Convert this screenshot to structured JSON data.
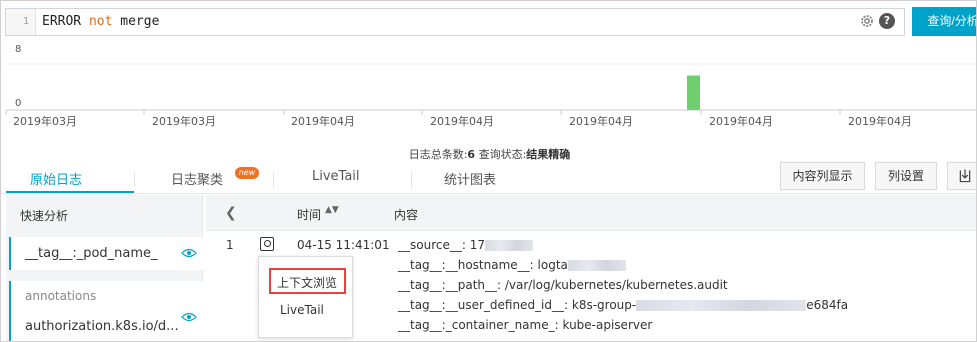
{
  "query": {
    "line_number": "1",
    "term1": "ERROR",
    "term2": "not",
    "term3": "merge",
    "search_button": "查询/分析"
  },
  "histogram": {
    "y_max_label": "8",
    "y_min_label": "0",
    "x_labels": [
      "2019年03月",
      "2019年03月",
      "2019年04月",
      "2019年04月",
      "2019年04月",
      "2019年04月",
      "2019年04月"
    ],
    "bar_value": 6,
    "bar_color": "#6fcf6f"
  },
  "summary": {
    "count_label": "日志总条数:",
    "count_value": "6",
    "status_label": "查询状态:",
    "status_value": "结果精确"
  },
  "tabs": {
    "raw_logs": "原始日志",
    "log_cluster": "日志聚类",
    "new_badge": "new",
    "livetail": "LiveTail",
    "stats_chart": "统计图表",
    "content_col_display": "内容列显示",
    "column_settings": "列设置"
  },
  "left_panel": {
    "title": "快速分析",
    "field1": "__tag__:_pod_name_",
    "field2_group": "annotations",
    "field2": "authorization.k8s.io/d..."
  },
  "table": {
    "col_time": "时间",
    "col_content": "内容",
    "row_index": "1",
    "row_time": "04-15 11:41:01",
    "source_key": "__source__:",
    "source_val": "17",
    "hostname_key": "__tag__:__hostname__:",
    "hostname_val": "logta",
    "path_key": "__tag__:__path__:",
    "path_val": "/var/log/kubernetes/kubernetes.audit",
    "udid_key": "__tag__:__user_defined_id__:",
    "udid_val_prefix": "k8s-group-",
    "udid_val_suffix": "e684fa",
    "container_key": "__tag__:_container_name_:",
    "container_val": "kube-apiserver"
  },
  "popup": {
    "context_browse": "上下文浏览",
    "livetail": "LiveTail"
  },
  "colors": {
    "accent": "#00a2ca",
    "highlight_border": "#e4443b",
    "badge": "#f27022"
  }
}
